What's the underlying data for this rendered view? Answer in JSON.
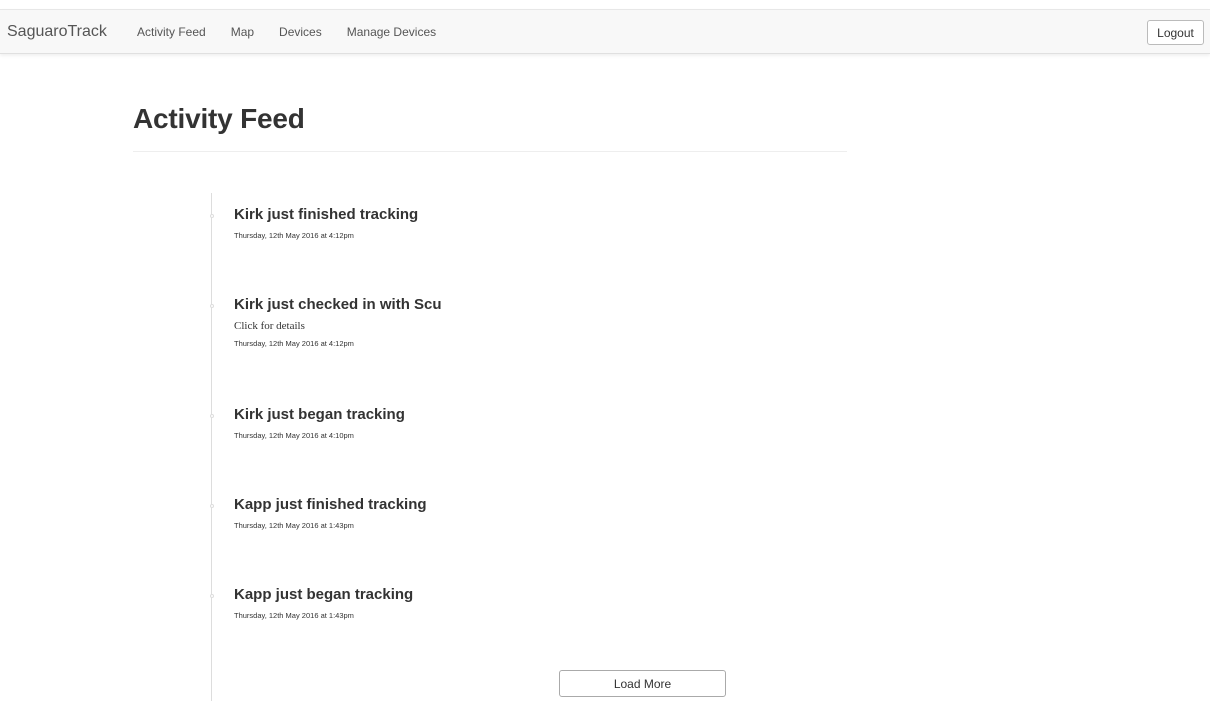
{
  "nav": {
    "brand": "SaguaroTrack",
    "links": [
      "Activity Feed",
      "Map",
      "Devices",
      "Manage Devices"
    ],
    "logout_label": "Logout"
  },
  "page": {
    "title": "Activity Feed"
  },
  "feed": {
    "items": [
      {
        "title": "Kirk just finished tracking",
        "time": "Thursday, 12th May 2016 at 4:12pm"
      },
      {
        "title": "Kirk just checked in with Scu",
        "details": "Click for details",
        "time": "Thursday, 12th May 2016 at 4:12pm"
      },
      {
        "title": "Kirk just began tracking",
        "time": "Thursday, 12th May 2016 at 4:10pm"
      },
      {
        "title": "Kapp just finished tracking",
        "time": "Thursday, 12th May 2016 at 1:43pm"
      },
      {
        "title": "Kapp just began tracking",
        "time": "Thursday, 12th May 2016 at 1:43pm"
      }
    ],
    "load_more_label": "Load More"
  }
}
